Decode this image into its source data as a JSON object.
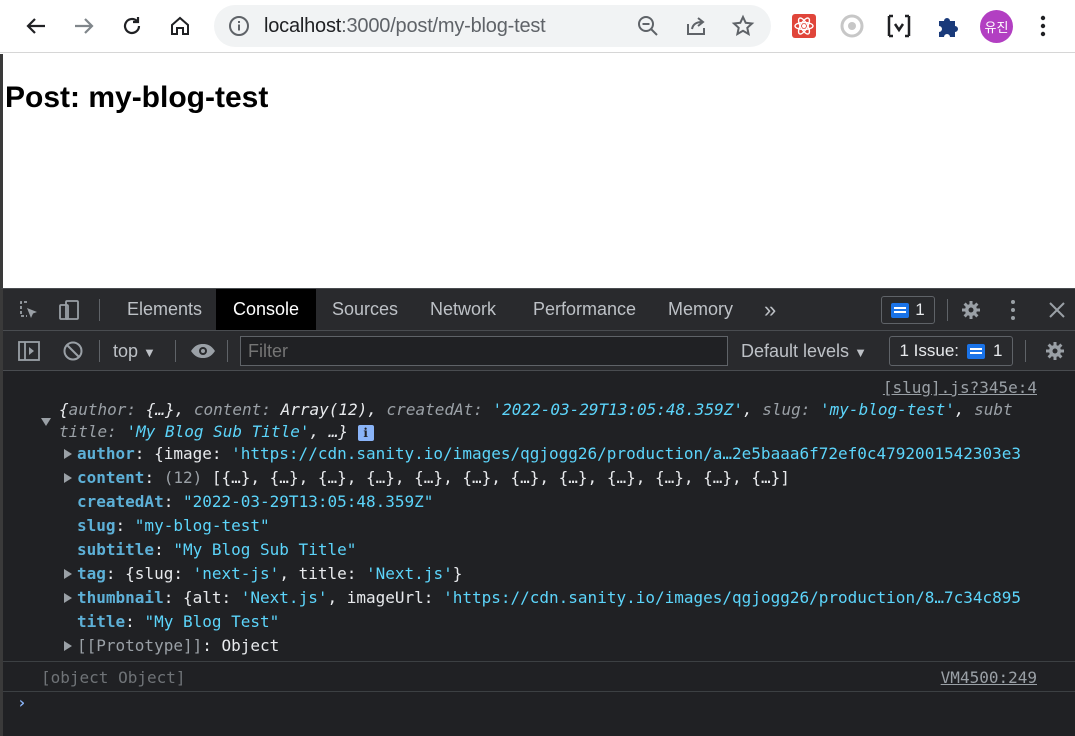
{
  "browser": {
    "url_host": "localhost",
    "url_path": ":3000/post/my-blog-test",
    "avatar_label": "유진",
    "icons": {
      "back": "back-arrow-icon",
      "forward": "forward-arrow-icon",
      "reload": "reload-icon",
      "home": "home-icon",
      "info": "site-info-icon",
      "zoom": "zoom-out-icon",
      "share": "share-icon",
      "bookmark": "star-icon"
    }
  },
  "page": {
    "heading": "Post: my-blog-test"
  },
  "devtools": {
    "tabs": [
      "Elements",
      "Console",
      "Sources",
      "Network",
      "Performance",
      "Memory"
    ],
    "active_tab": "Console",
    "more_tabs": "»",
    "messages_count": "1",
    "context": "top",
    "filter_placeholder": "Filter",
    "default_levels": "Default levels",
    "issues_label": "1 Issue:",
    "issues_count": "1",
    "console": {
      "source_1": "[slug].js?345e:4",
      "summary": {
        "open": "{",
        "k_author": "author",
        "v_author": "{…}",
        "k_content": "content",
        "v_content": "Array(12)",
        "k_createdAt": "createdAt",
        "v_createdAt": "'2022-03-29T13:05:48.359Z'",
        "k_slug": "slug",
        "v_slug": "'my-blog-test'",
        "k_subt": "subt",
        "k_title": "title",
        "v_title": "'My Blog Sub Title'",
        "tail": ", …}"
      },
      "props": {
        "author_key": "author",
        "author_pre": "{image: ",
        "author_val": "'https://cdn.sanity.io/images/qgjogg26/production/a…2e5baaa6f72ef0c4792001542303e3",
        "content_key": "content",
        "content_count": "(12)",
        "content_val": "[{…}, {…}, {…}, {…}, {…}, {…}, {…}, {…}, {…}, {…}, {…}, {…}]",
        "createdAt_key": "createdAt",
        "createdAt_val": "\"2022-03-29T13:05:48.359Z\"",
        "slug_key": "slug",
        "slug_val": "\"my-blog-test\"",
        "subtitle_key": "subtitle",
        "subtitle_val": "\"My Blog Sub Title\"",
        "tag_key": "tag",
        "tag_pre": "{slug: ",
        "tag_slug": "'next-js'",
        "tag_mid": ", title: ",
        "tag_title": "'Next.js'",
        "tag_end": "}",
        "thumb_key": "thumbnail",
        "thumb_pre": "{alt: ",
        "thumb_alt": "'Next.js'",
        "thumb_mid": ", imageUrl: ",
        "thumb_url": "'https://cdn.sanity.io/images/qgjogg26/production/8…7c34c895",
        "title_key": "title",
        "title_val": "\"My Blog Test\"",
        "proto_key": "[[Prototype]]",
        "proto_val": "Object"
      },
      "log_2": "[object Object]",
      "source_2": "VM4500:249",
      "prompt": "›"
    }
  },
  "colors": {
    "devtools_bg": "#202124",
    "key_blue": "#5db0d7",
    "string_cyan": "#5cd5fb",
    "avatar_purple": "#b23fc2"
  }
}
